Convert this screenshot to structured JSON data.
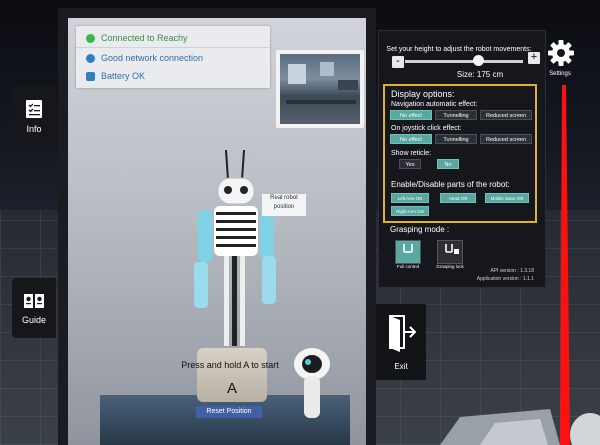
{
  "status": {
    "items": [
      {
        "label": "Connected to Reachy",
        "icon": "check-circle-icon",
        "color": "#3cb54a"
      },
      {
        "label": "Good network connection",
        "icon": "network-icon",
        "color": "#2f7fbf"
      },
      {
        "label": "Battery OK",
        "icon": "battery-icon",
        "color": "#2f7fbf"
      }
    ]
  },
  "side_tabs": {
    "info": "Info",
    "guide": "Guide"
  },
  "settings": {
    "height_label": "Set your height to adjust the robot movements:",
    "minus": "-",
    "plus": "+",
    "size_label": "Size: 175 cm",
    "height_fraction": 0.62,
    "settings_label": "Settings",
    "display_title": "Display options:",
    "nav_label": "Navigation automatic effect:",
    "nav_options": [
      "No effect",
      "Tunnelling",
      "Reduced screen"
    ],
    "nav_selected": 0,
    "joystick_label": "On joystick click effect:",
    "joystick_options": [
      "No effect",
      "Tunnelling",
      "Reduced screen"
    ],
    "joystick_selected": 0,
    "reticle_label": "Show reticle:",
    "reticle_options": [
      "Yes",
      "No"
    ],
    "reticle_selected": 1,
    "parts_title": "Enable/Disable parts of the robot:",
    "parts": [
      "Left Arm ON",
      "Head ON",
      "Mobile Base ON",
      "Right Arm ON"
    ],
    "grasping_title": "Grasping mode :",
    "grasping_modes": [
      "Full control",
      "Grasping lock"
    ],
    "grasping_selected": 0,
    "api_version": "API version : 1.3.18",
    "app_version": "Application version : 1.1.1",
    "accent": "#e0b12a",
    "selected_color": "#5aa6a0"
  },
  "exit_label": "Exit",
  "robot": {
    "real_label": "Real robot position"
  },
  "instructions": {
    "press_text": "Press and hold A to start",
    "button_letter": "A",
    "reset_label": "Reset Position"
  }
}
